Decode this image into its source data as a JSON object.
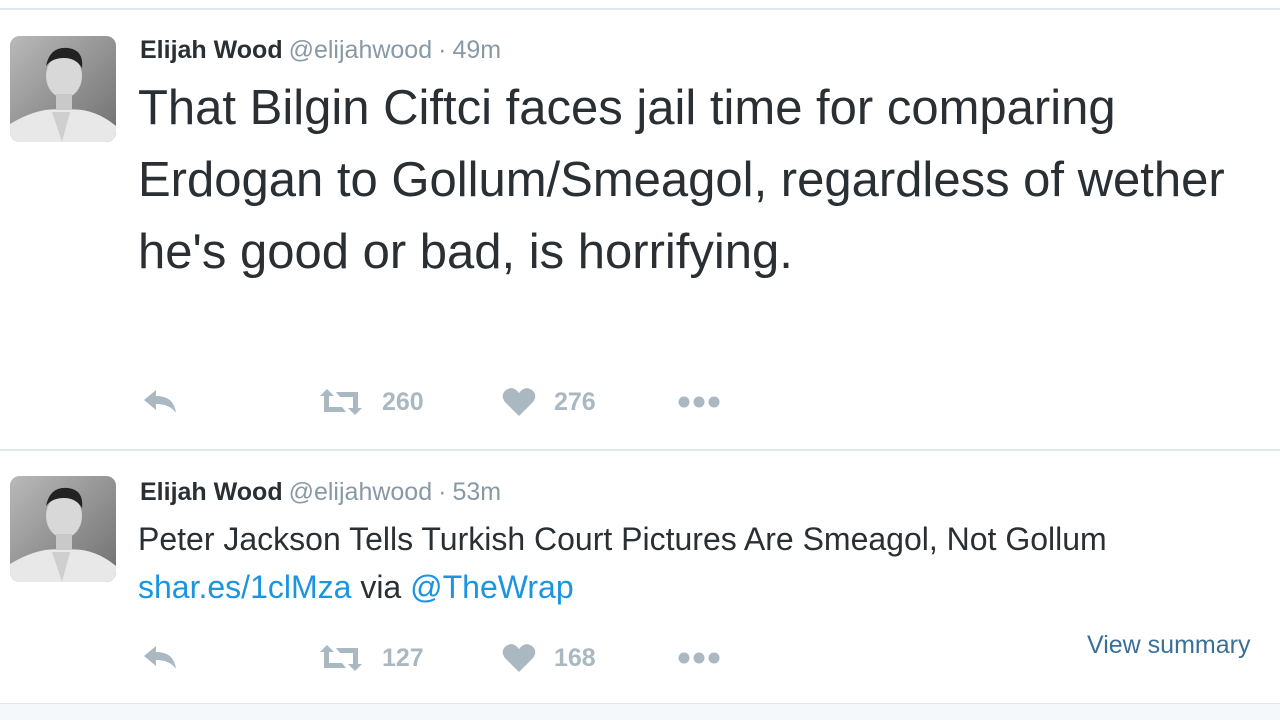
{
  "tweets": [
    {
      "author_name": "Elijah Wood",
      "handle": "@elijahwood",
      "separator": "·",
      "time": "49m",
      "text": "That Bilgin Ciftci faces jail time for comparing Erdogan to Gollum/Smeagol, regardless of wether he's good or bad, is horrifying.",
      "retweets": "260",
      "likes": "276"
    },
    {
      "author_name": "Elijah Wood",
      "handle": "@elijahwood",
      "separator": "·",
      "time": "53m",
      "text": "Peter Jackson Tells Turkish Court Pictures Are Smeagol, Not Gollum",
      "link_text": "shar.es/1clMza",
      "via_text": "via",
      "mention": "@TheWrap",
      "retweets": "127",
      "likes": "168",
      "view_summary": "View summary"
    }
  ],
  "icons": {
    "reply": "reply-icon",
    "retweet": "retweet-icon",
    "like": "heart-icon",
    "more": "more-icon"
  },
  "colors": {
    "text": "#292f33",
    "muted": "#8899a6",
    "action": "#aab8c2",
    "link": "#1b95e0",
    "link_dark": "#3b6f98",
    "divider": "#e1e8ed"
  }
}
